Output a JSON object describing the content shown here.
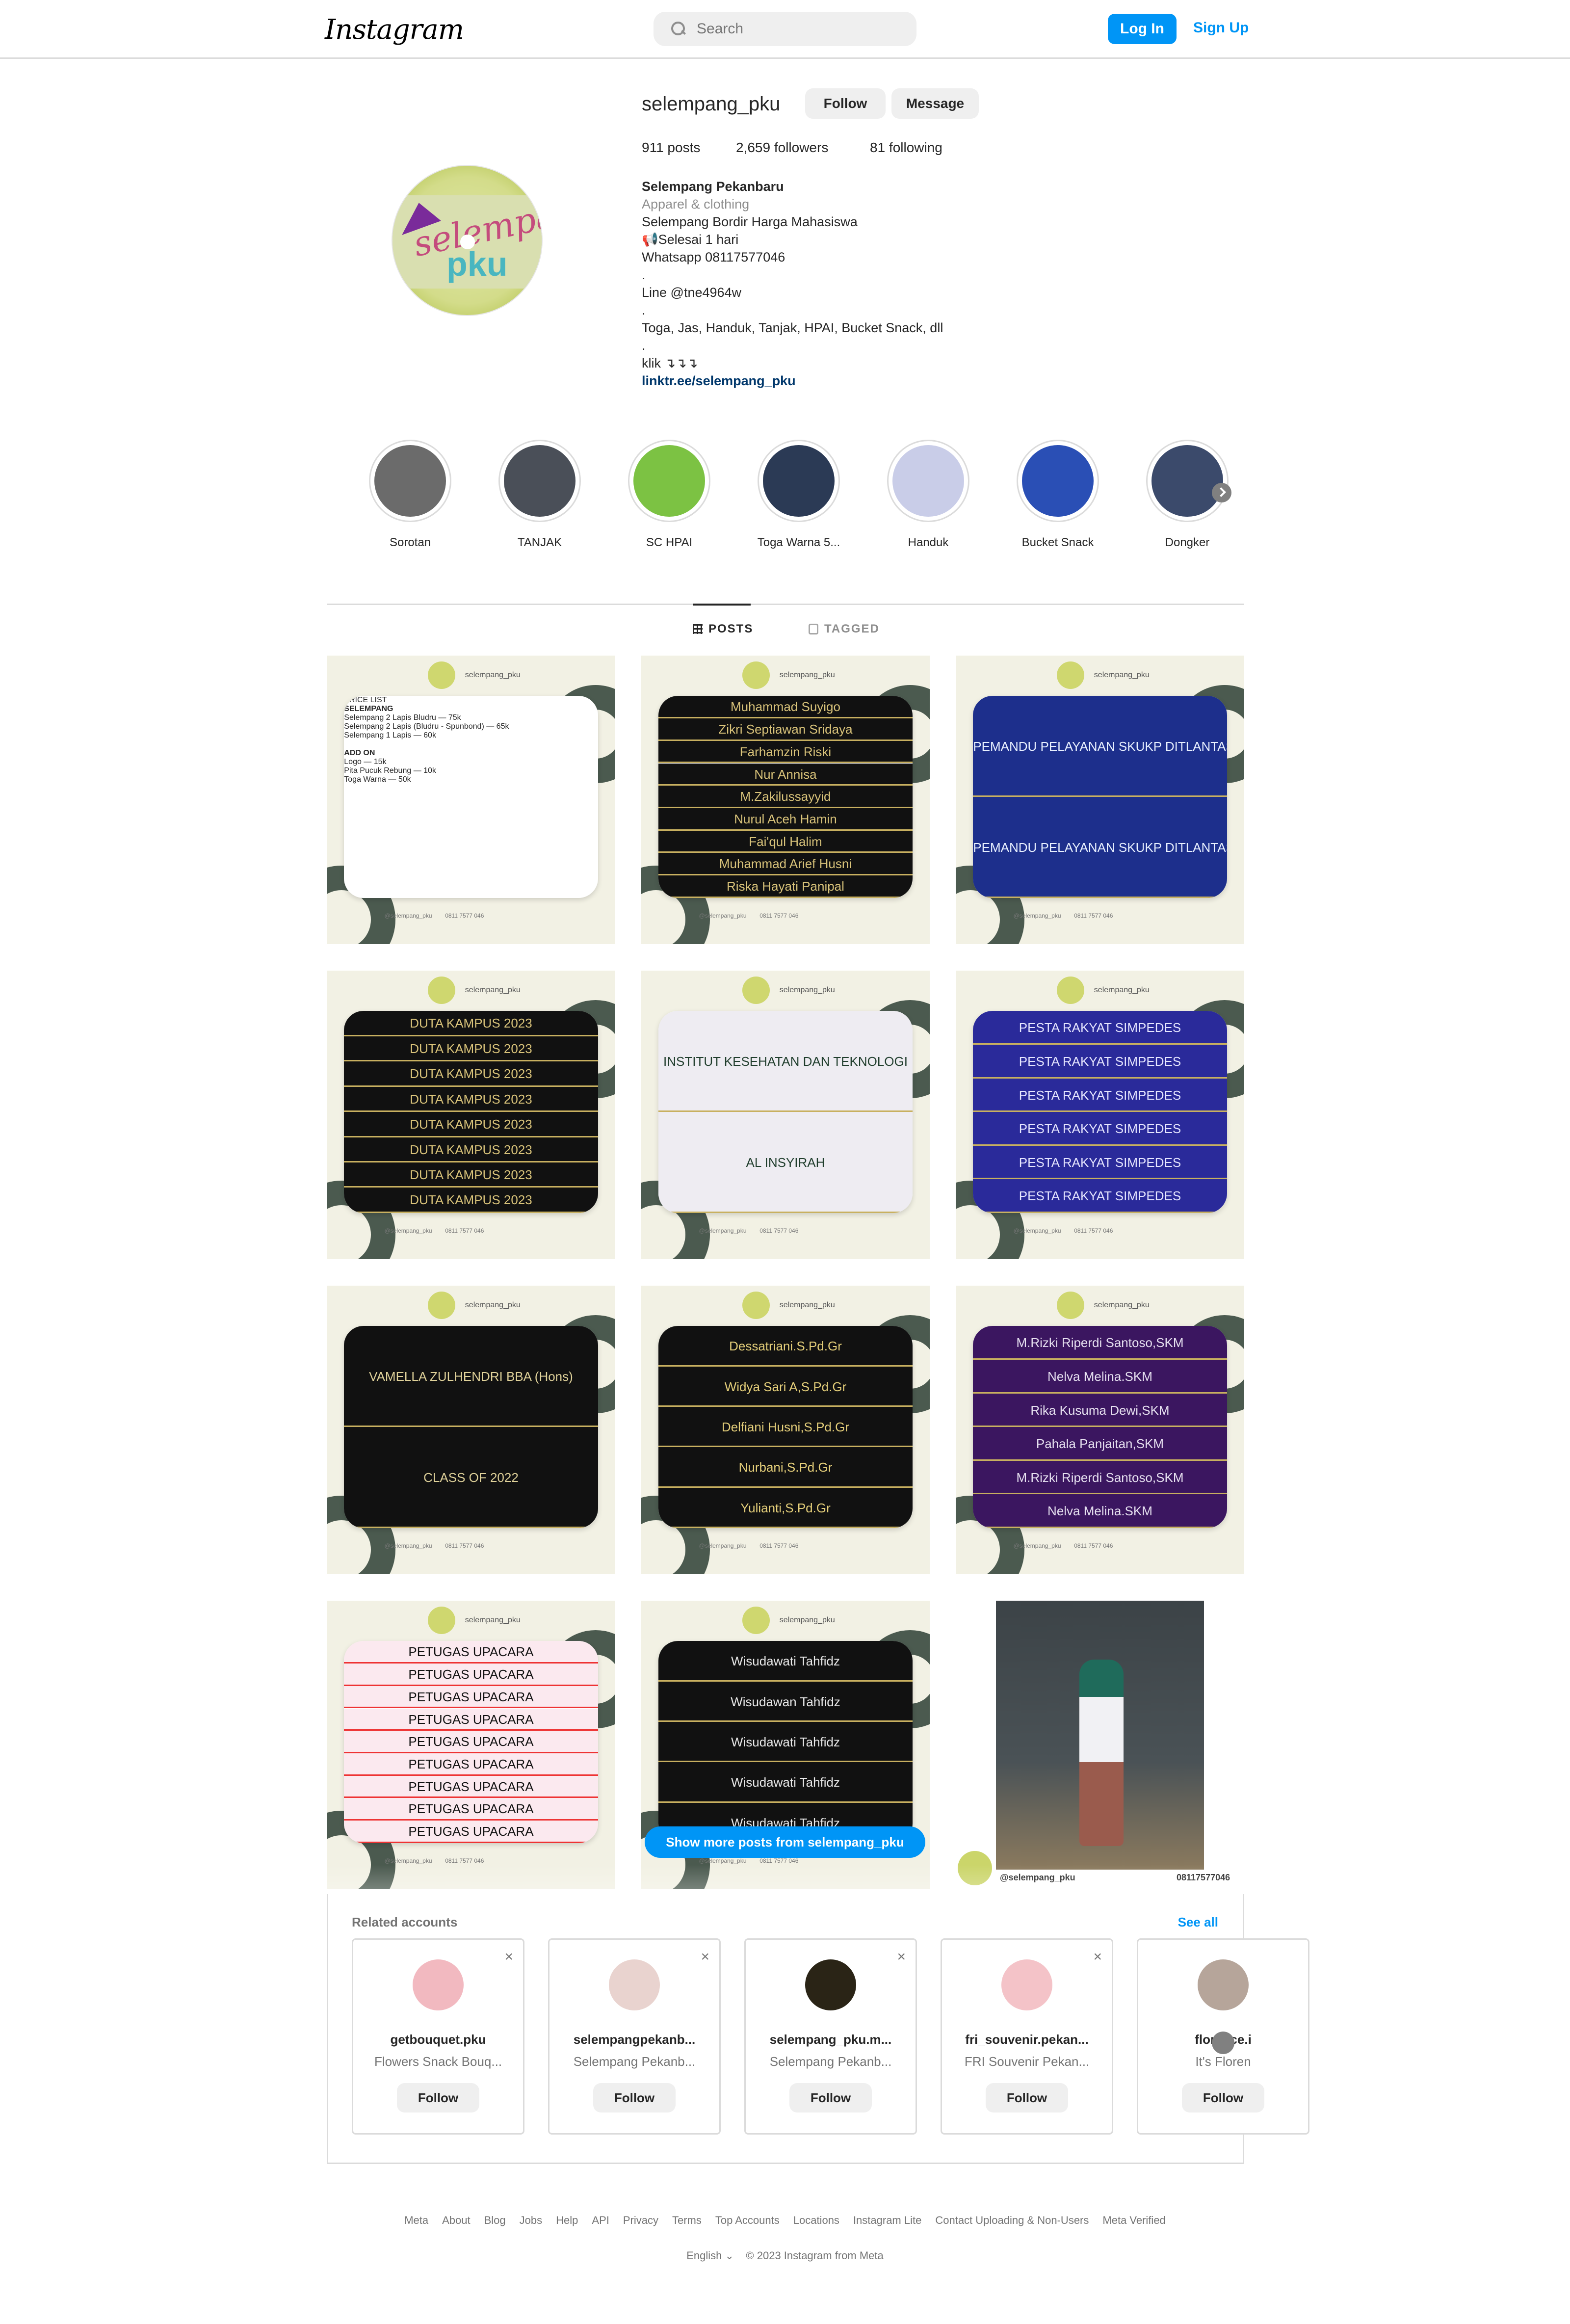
{
  "header": {
    "logo": "Instagram",
    "search_placeholder": "Search",
    "login_label": "Log In",
    "signup_label": "Sign Up"
  },
  "profile": {
    "username": "selempang_pku",
    "follow_label": "Follow",
    "message_label": "Message",
    "stats": {
      "posts": "911 posts",
      "followers": "2,659 followers",
      "following": "81 following"
    },
    "bio": {
      "name": "Selempang Pekanbaru",
      "category": "Apparel & clothing",
      "lines": [
        "Selempang Bordir Harga Mahasiswa",
        "📢Selesai 1 hari",
        "Whatsapp 08117577046",
        ".",
        "Line @tne4964w",
        ".",
        "Toga, Jas, Handuk, Tanjak, HPAI, Bucket Snack, dll",
        ".",
        "klik ↴↴↴"
      ],
      "link": "linktr.ee/selempang_pku"
    },
    "avatar_text": "selempang pku"
  },
  "highlights": [
    {
      "label": "Sorotan",
      "color": "#6b6b6b"
    },
    {
      "label": "TANJAK",
      "color": "#4a4f58"
    },
    {
      "label": "SC HPAI",
      "color": "#7cc243"
    },
    {
      "label": "Toga Warna 5...",
      "color": "#2b3a55"
    },
    {
      "label": "Handuk",
      "color": "#c9cde8"
    },
    {
      "label": "Bucket Snack",
      "color": "#2a4fb5"
    },
    {
      "label": "Dongker",
      "color": "#3b4a6b"
    }
  ],
  "tabs": {
    "posts": "POSTS",
    "tagged": "TAGGED"
  },
  "posts": [
    {
      "title": "PRICE LIST",
      "section1": "SELEMPANG",
      "items": [
        "Selempang 2 Lapis Bludru — 75k",
        "Selempang 2 Lapis (Bludru - Spunbond) — 65k",
        "Selempang 1 Lapis — 60k"
      ],
      "section2": "ADD ON",
      "addons": [
        "Logo — 15k",
        "Pita Pucuk Rebung — 10k",
        "Toga Warna — 50k"
      ]
    },
    {
      "strips": [
        "Muhammad Suyigo",
        "Zikri Septiawan Sridaya",
        "Farhamzin Riski",
        "Nur Annisa",
        "M.Zakilussayyid",
        "Nurul Aceh Hamin",
        "Fai'qul Halim",
        "Muhammad Arief Husni",
        "Riska Hayati Panipal"
      ],
      "bg": "#111",
      "fg": "#d9c37a"
    },
    {
      "strips": [
        "PEMANDU PELAYANAN SKUKP DITLANTAS POLDA RIAU",
        "PEMANDU PELAYANAN SKUKP DITLANTAS POLDA RIAU"
      ],
      "bg": "#1d2f8c",
      "fg": "#e8f0ff"
    },
    {
      "strips": [
        "DUTA KAMPUS 2023",
        "DUTA KAMPUS 2023",
        "DUTA KAMPUS 2023",
        "DUTA KAMPUS 2023",
        "DUTA KAMPUS 2023",
        "DUTA KAMPUS 2023",
        "DUTA KAMPUS 2023",
        "DUTA KAMPUS 2023"
      ],
      "bg": "#111",
      "fg": "#d9c37a"
    },
    {
      "strips": [
        "INSTITUT KESEHATAN DAN TEKNOLOGI",
        "AL INSYIRAH"
      ],
      "bg": "#eeecf2",
      "fg": "#1f3d2c"
    },
    {
      "strips": [
        "PESTA RAKYAT SIMPEDES",
        "PESTA RAKYAT SIMPEDES",
        "PESTA RAKYAT SIMPEDES",
        "PESTA RAKYAT SIMPEDES",
        "PESTA RAKYAT SIMPEDES",
        "PESTA RAKYAT SIMPEDES"
      ],
      "bg": "#2a2a9a",
      "fg": "#e6e6ff"
    },
    {
      "strips": [
        "VAMELLA ZULHENDRI BBA (Hons)",
        "CLASS OF 2022"
      ],
      "bg": "#111",
      "fg": "#e0d29a"
    },
    {
      "strips": [
        "Dessatriani.S.Pd.Gr",
        "Widya Sari A,S.Pd.Gr",
        "Delfiani Husni,S.Pd.Gr",
        "Nurbani,S.Pd.Gr",
        "Yulianti,S.Pd.Gr"
      ],
      "bg": "#111",
      "fg": "#e5cf7a"
    },
    {
      "strips": [
        "M.Rizki Riperdi Santoso,SKM",
        "Nelva Melina.SKM",
        "Rika Kusuma Dewi,SKM",
        "Pahala Panjaitan,SKM",
        "M.Rizki Riperdi Santoso,SKM",
        "Nelva Melina.SKM"
      ],
      "bg": "#3b1660",
      "fg": "#e6e0f0"
    },
    {
      "strips": [
        "PETUGAS UPACARA",
        "PETUGAS UPACARA",
        "PETUGAS UPACARA",
        "PETUGAS UPACARA",
        "PETUGAS UPACARA",
        "PETUGAS UPACARA",
        "PETUGAS UPACARA",
        "PETUGAS UPACARA",
        "PETUGAS UPACARA"
      ],
      "bg": "#fbe9ef",
      "fg": "#111"
    },
    {
      "strips": [
        "Wisudawati Tahfidz",
        "Wisudawan Tahfidz",
        "Wisudawati Tahfidz",
        "Wisudawati Tahfidz",
        "Wisudawati Tahfidz"
      ],
      "bg": "#111",
      "fg": "#e8e8e8"
    },
    {
      "caption_ig": "@selempang_pku",
      "caption_wa": "08117577046"
    }
  ],
  "post_common": {
    "handle": "selempang_pku",
    "footer_ig": "@selempang_pku",
    "footer_wa": "0811 7577 046"
  },
  "show_more_label": "Show more posts from selempang_pku",
  "related": {
    "title": "Related accounts",
    "see_all": "See all",
    "accounts": [
      {
        "name": "getbouquet.pku",
        "desc": "Flowers Snack Bouq...",
        "color": "#f2b9c0",
        "follow": "Follow"
      },
      {
        "name": "selempangpekanb...",
        "desc": "Selempang Pekanb...",
        "color": "#e9d3cf",
        "follow": "Follow"
      },
      {
        "name": "selempang_pku.m...",
        "desc": "Selempang Pekanb...",
        "color": "#2a2416",
        "follow": "Follow"
      },
      {
        "name": "fri_souvenir.pekan...",
        "desc": "FRI Souvenir Pekan...",
        "color": "#f4c3c8",
        "follow": "Follow"
      },
      {
        "name": "florence.i",
        "desc": "It's Floren",
        "color": "#b6a59a",
        "follow": "Follow"
      }
    ]
  },
  "footer": {
    "links": [
      "Meta",
      "About",
      "Blog",
      "Jobs",
      "Help",
      "API",
      "Privacy",
      "Terms",
      "Top Accounts",
      "Locations",
      "Instagram Lite",
      "Contact Uploading & Non-Users",
      "Meta Verified"
    ],
    "language": "English",
    "copyright": "© 2023 Instagram from Meta"
  }
}
